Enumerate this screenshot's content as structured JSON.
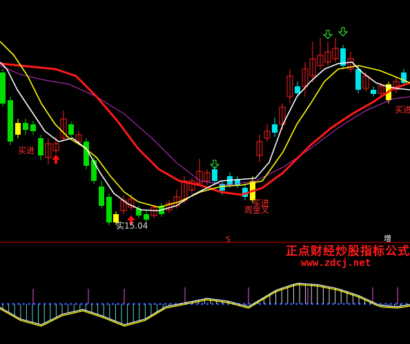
{
  "colors": {
    "background": "#000000",
    "up_candle": "#ff2020",
    "down_candle": "#00dd00",
    "signal_candle": "#00e5ee",
    "yellow_candle": "#ffff00",
    "ma_white": "#ffffff",
    "ma_yellow": "#ffff00",
    "ma_red": "#ff1a1a",
    "ma_purple": "#cc33cc",
    "divider": "#cc0000",
    "baseline_dots": "#3355ff",
    "label_red": "#ff3030"
  },
  "icons": {
    "up_arrow": "red-up-arrow-icon",
    "down_arrow": "green-down-arrow-icon"
  },
  "labels": {
    "buy_left": "买进",
    "buy_mid": "买进",
    "buy_right": "买进",
    "low_price": "实15.04",
    "weekly_cross": "周金叉",
    "add_marker": "增",
    "s_marker": "S"
  },
  "watermark": {
    "title": "正点财经炒股指标公式",
    "url": "www.zdcj.net"
  }
}
